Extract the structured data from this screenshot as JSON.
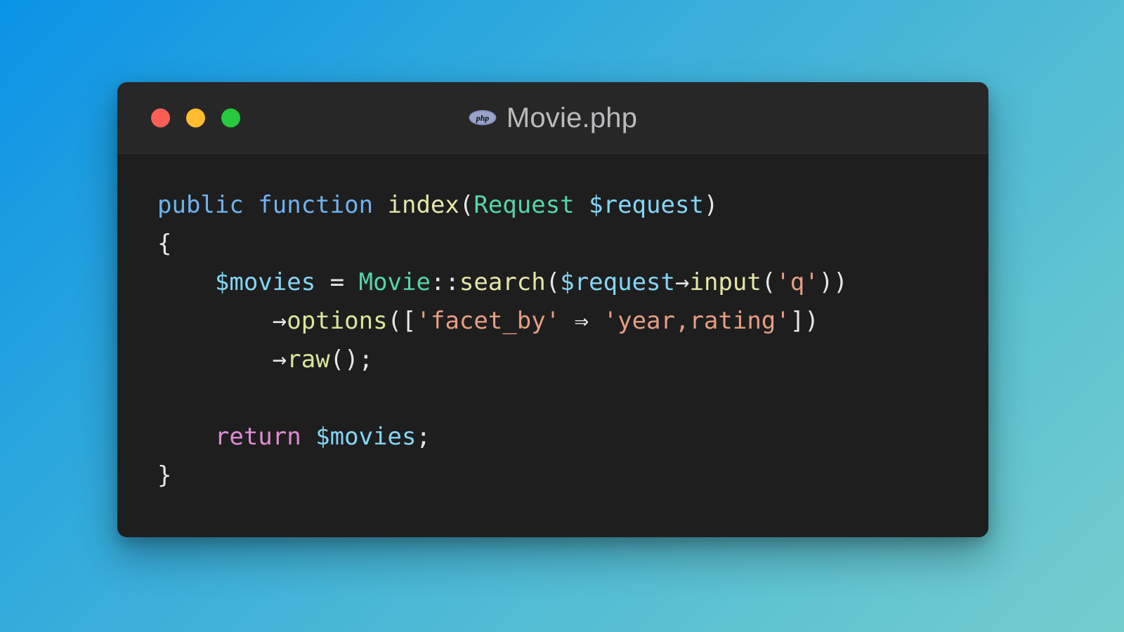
{
  "background": {
    "gradient_from": "#0b93e6",
    "gradient_to": "#74cdcd",
    "direction": "135deg"
  },
  "window": {
    "titlebar": {
      "traffic_lights": [
        {
          "name": "close",
          "color": "#fb5f56"
        },
        {
          "name": "minimize",
          "color": "#febc2e"
        },
        {
          "name": "zoom",
          "color": "#28c83f"
        }
      ],
      "file_icon": "php-logo-icon",
      "file_icon_color": "#8892bf",
      "title": "Movie.php"
    },
    "background_color": "#1e1e1e",
    "titlebar_color": "#272727"
  },
  "code": {
    "language": "php",
    "plain_text": "public function index(Request $request)\n{\n    $movies = Movie::search($request→input('q'))\n        →options(['facet_by' ⇒ 'year,rating'])\n        →raw();\n\n    return $movies;\n}",
    "lines": [
      {
        "index": 1,
        "text": "public function index(Request $request)",
        "tokens": [
          {
            "t": "public function ",
            "c": "t-keyword"
          },
          {
            "t": "index",
            "c": "t-fn"
          },
          {
            "t": "(",
            "c": "t-punct"
          },
          {
            "t": "Request",
            "c": "t-class"
          },
          {
            "t": " ",
            "c": "t-punct"
          },
          {
            "t": "$request",
            "c": "t-var"
          },
          {
            "t": ")",
            "c": "t-punct"
          }
        ]
      },
      {
        "index": 2,
        "text": "{",
        "tokens": [
          {
            "t": "{",
            "c": "t-punct"
          }
        ]
      },
      {
        "index": 3,
        "text": "    $movies = Movie::search($request→input('q'))",
        "tokens": [
          {
            "t": "    ",
            "c": "t-punct"
          },
          {
            "t": "$movies",
            "c": "t-var"
          },
          {
            "t": " = ",
            "c": "t-punct"
          },
          {
            "t": "Movie",
            "c": "t-class"
          },
          {
            "t": "::",
            "c": "t-punct"
          },
          {
            "t": "search",
            "c": "t-fn"
          },
          {
            "t": "(",
            "c": "t-punct"
          },
          {
            "t": "$request",
            "c": "t-var"
          },
          {
            "t": "→",
            "c": "t-punct"
          },
          {
            "t": "input",
            "c": "t-fn"
          },
          {
            "t": "(",
            "c": "t-punct"
          },
          {
            "t": "'q'",
            "c": "t-string"
          },
          {
            "t": "))",
            "c": "t-punct"
          }
        ]
      },
      {
        "index": 4,
        "text": "        →options(['facet_by' ⇒ 'year,rating'])",
        "tokens": [
          {
            "t": "        ",
            "c": "t-punct"
          },
          {
            "t": "→",
            "c": "t-punct"
          },
          {
            "t": "options",
            "c": "t-method"
          },
          {
            "t": "([",
            "c": "t-punct"
          },
          {
            "t": "'facet_by'",
            "c": "t-string"
          },
          {
            "t": " ⇒ ",
            "c": "t-punct"
          },
          {
            "t": "'year,rating'",
            "c": "t-string"
          },
          {
            "t": "])",
            "c": "t-punct"
          }
        ]
      },
      {
        "index": 5,
        "text": "        →raw();",
        "tokens": [
          {
            "t": "        ",
            "c": "t-punct"
          },
          {
            "t": "→",
            "c": "t-punct"
          },
          {
            "t": "raw",
            "c": "t-method"
          },
          {
            "t": "();",
            "c": "t-punct"
          }
        ]
      },
      {
        "index": 6,
        "text": "",
        "tokens": []
      },
      {
        "index": 7,
        "text": "    return $movies;",
        "tokens": [
          {
            "t": "    ",
            "c": "t-punct"
          },
          {
            "t": "return",
            "c": "t-return"
          },
          {
            "t": " ",
            "c": "t-punct"
          },
          {
            "t": "$movies",
            "c": "t-var"
          },
          {
            "t": ";",
            "c": "t-punct"
          }
        ]
      },
      {
        "index": 8,
        "text": "}",
        "tokens": [
          {
            "t": "}",
            "c": "t-punct"
          }
        ]
      }
    ]
  },
  "php_badge": {
    "label": "php"
  }
}
